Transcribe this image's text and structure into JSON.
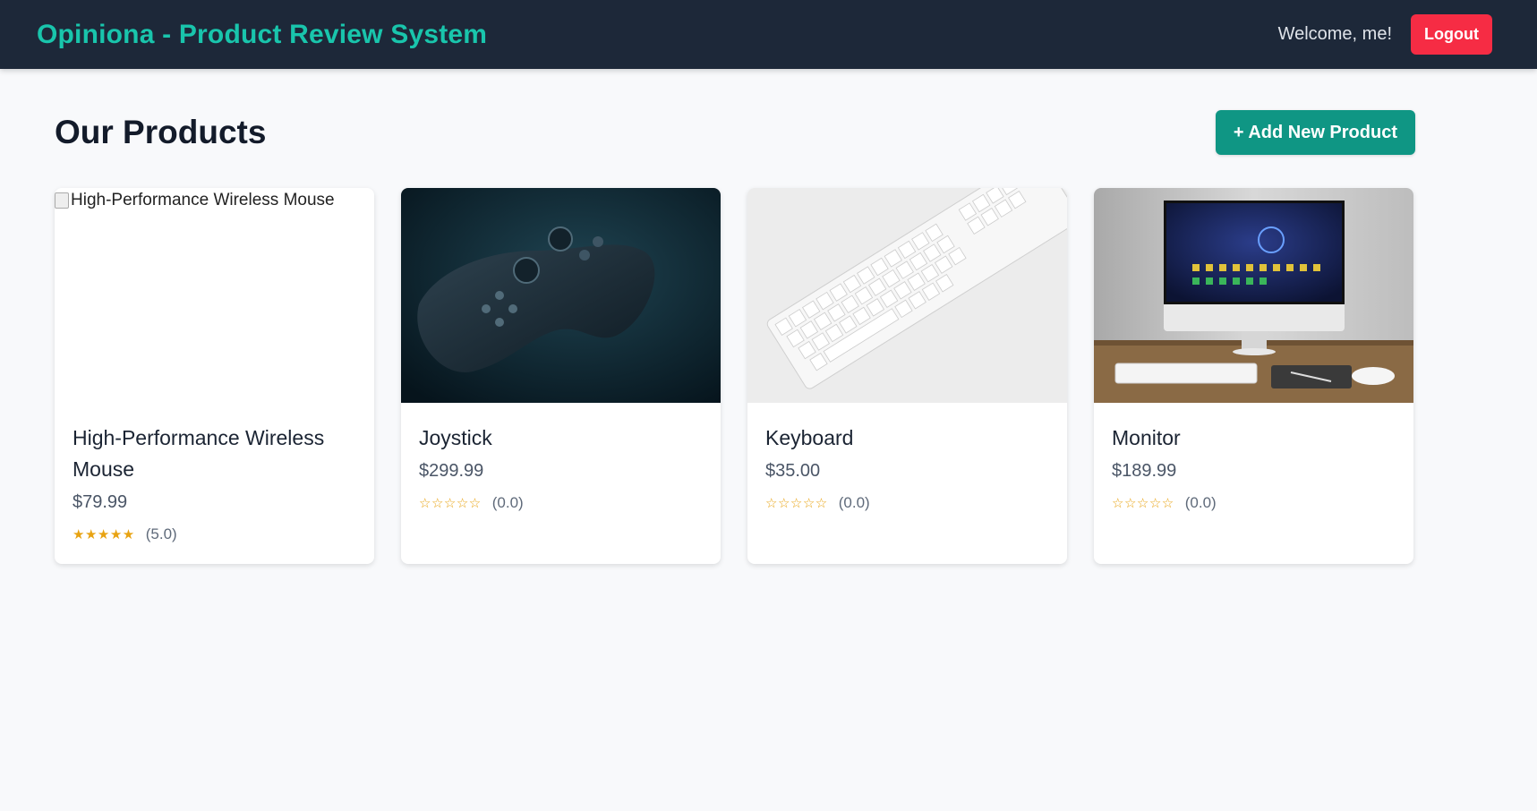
{
  "header": {
    "brand": "Opiniona - Product Review System",
    "welcome": "Welcome, me!",
    "logout_label": "Logout"
  },
  "page": {
    "title": "Our Products",
    "add_button_label": "+ Add New Product"
  },
  "colors": {
    "brand_teal": "#19c5ac",
    "nav_bg": "#1d2839",
    "logout_red": "#f62c44",
    "add_green": "#0f9684",
    "star_gold": "#e8a312"
  },
  "products": [
    {
      "name": "High-Performance Wireless Mouse",
      "price": "$79.99",
      "stars": "★★★★★",
      "rating": 5.0,
      "rating_text": "(5.0)",
      "image_alt": "High-Performance Wireless Mouse",
      "image": "broken-image"
    },
    {
      "name": "Joystick",
      "price": "$299.99",
      "stars": "☆☆☆☆☆",
      "rating": 0.0,
      "rating_text": "(0.0)",
      "image": "gamepad-photo"
    },
    {
      "name": "Keyboard",
      "price": "$35.00",
      "stars": "☆☆☆☆☆",
      "rating": 0.0,
      "rating_text": "(0.0)",
      "image": "keyboard-photo"
    },
    {
      "name": "Monitor",
      "price": "$189.99",
      "stars": "☆☆☆☆☆",
      "rating": 0.0,
      "rating_text": "(0.0)",
      "image": "monitor-photo"
    }
  ]
}
